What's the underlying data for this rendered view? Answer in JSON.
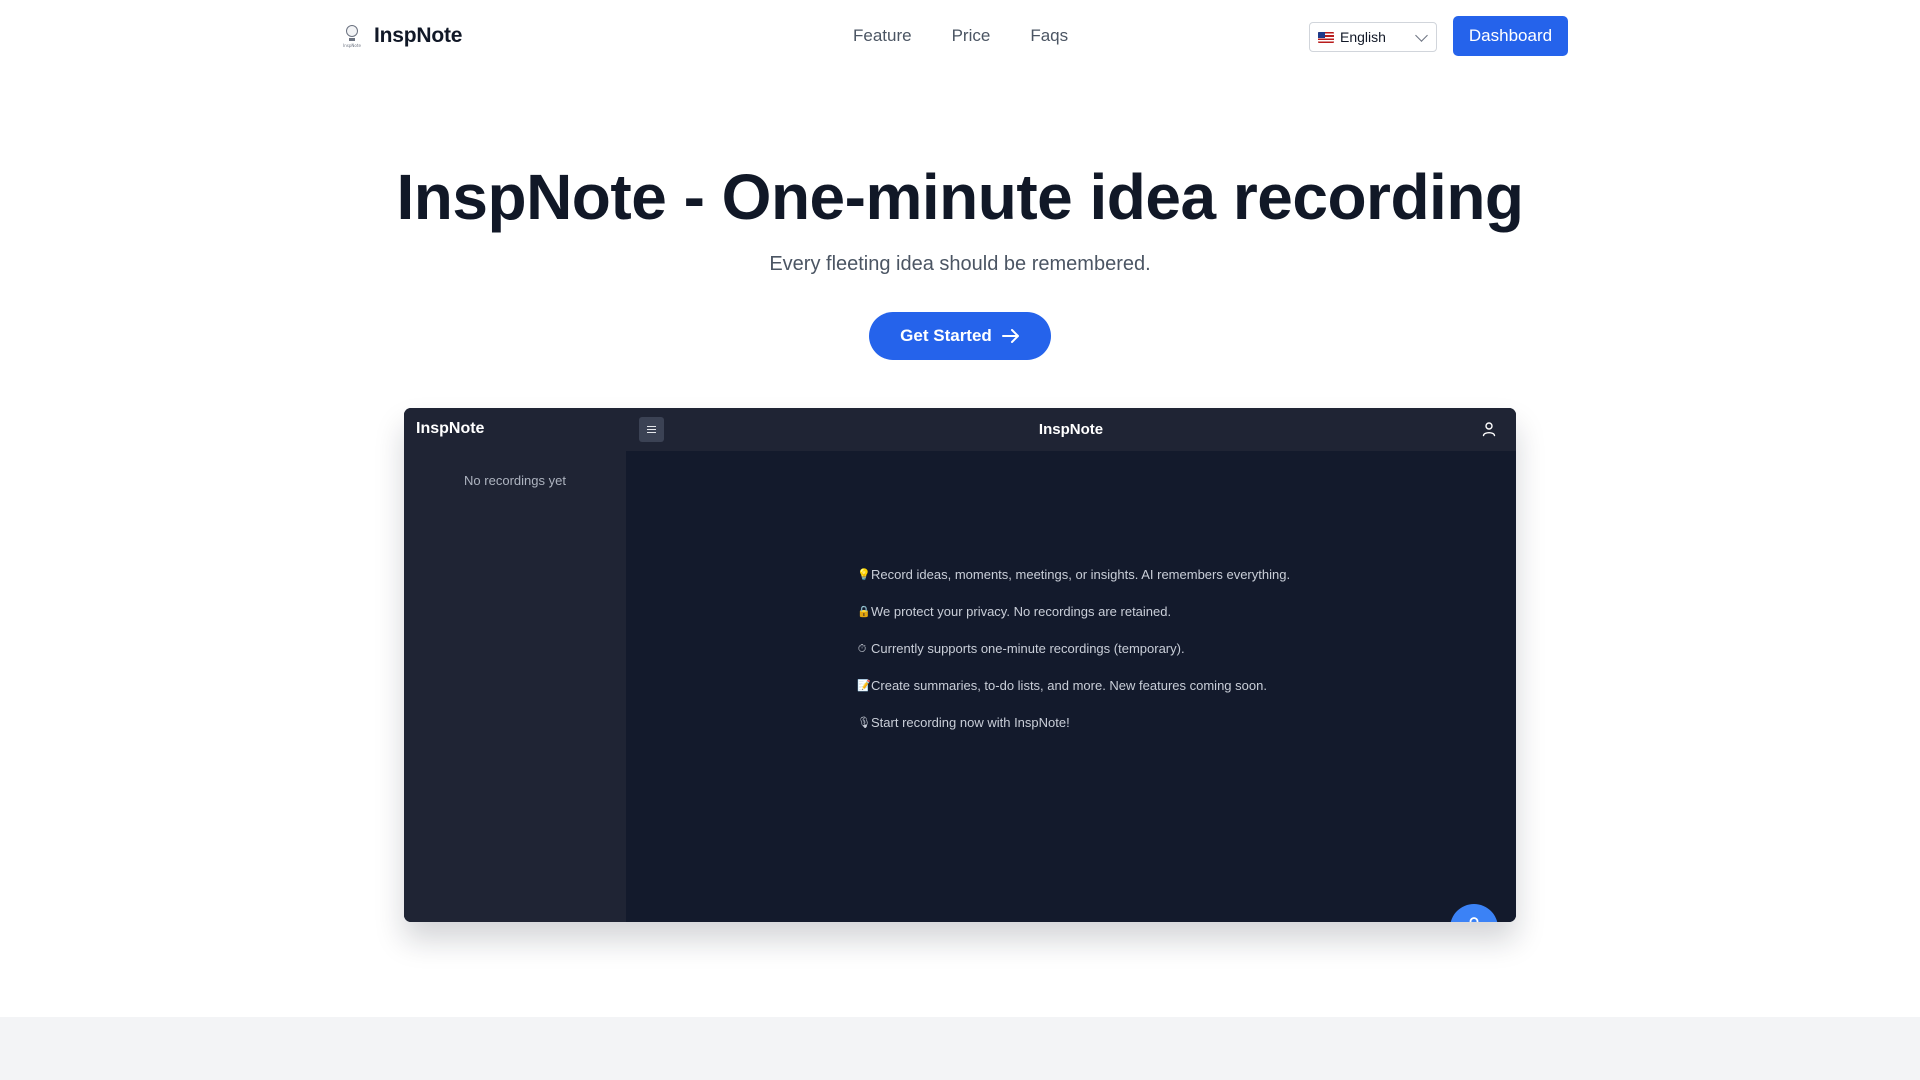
{
  "header": {
    "brand": "InspNote",
    "logo_caption": "InspNote",
    "nav": [
      {
        "label": "Feature"
      },
      {
        "label": "Price"
      },
      {
        "label": "Faqs"
      }
    ],
    "language": {
      "selected": "English",
      "flag_icon": "us-flag-icon"
    },
    "dashboard_label": "Dashboard"
  },
  "hero": {
    "title": "InspNote - One-minute idea recording",
    "subtitle": "Every fleeting idea should be remembered.",
    "cta_label": "Get Started"
  },
  "preview": {
    "brand": "InspNote",
    "title": "InspNote",
    "sidebar_empty": "No recordings yet",
    "lines": [
      {
        "emoji": "💡",
        "text": "Record ideas, moments, meetings, or insights. AI remembers everything."
      },
      {
        "emoji": "🔒",
        "text": "We protect your privacy. No recordings are retained."
      },
      {
        "emoji": "⏱",
        "text": "Currently supports one-minute recordings (temporary)."
      },
      {
        "emoji": "📝",
        "text": "Create summaries, to-do lists, and more. New features coming soon."
      },
      {
        "emoji": "🎙",
        "text": "Start recording now with InspNote!"
      }
    ]
  },
  "colors": {
    "accent": "#2563eb",
    "mic": "#3b82f6",
    "preview_bg": "#131a2c",
    "preview_panel": "#1f2434"
  }
}
